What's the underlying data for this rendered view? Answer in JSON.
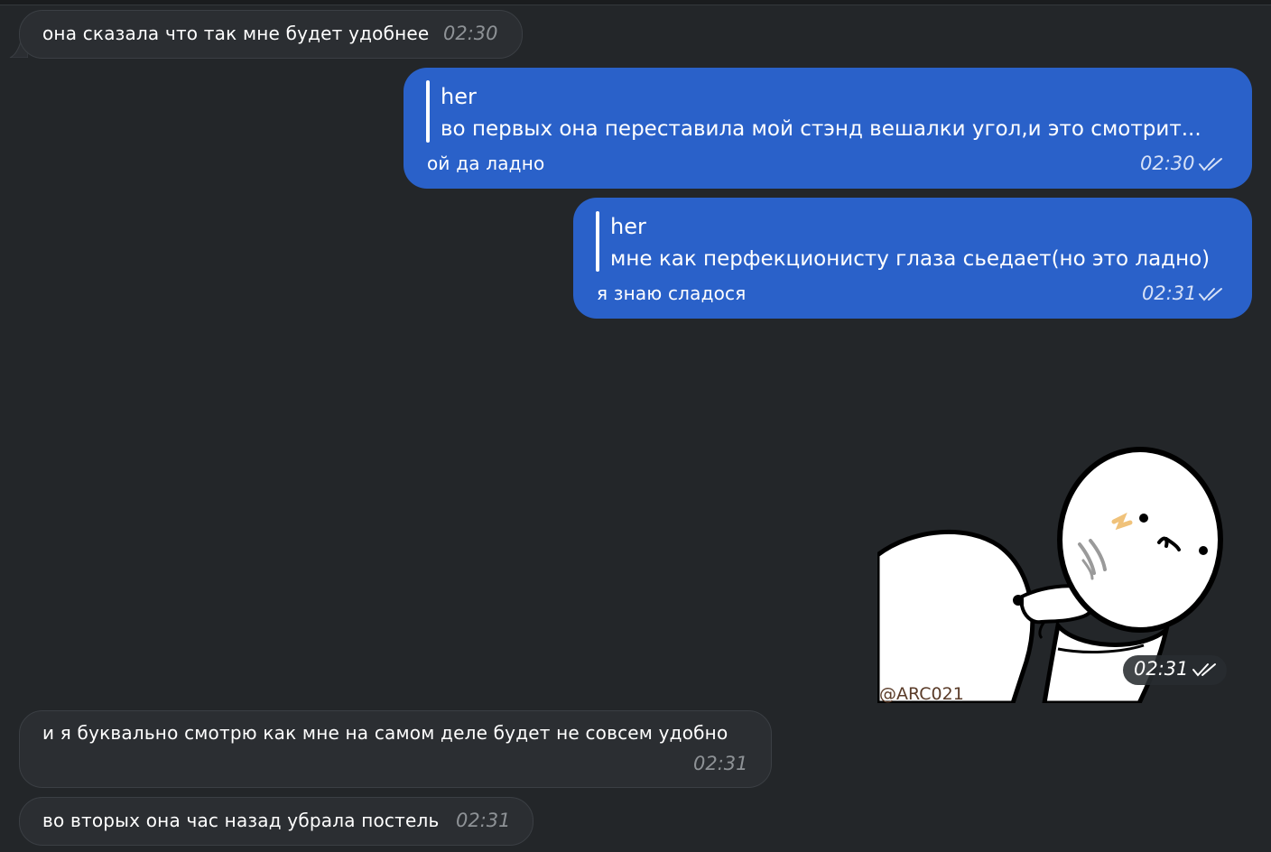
{
  "messages": [
    {
      "text": "она сказала что так мне будет удобнее",
      "time": "02:30"
    },
    {
      "reply_to": "her",
      "reply_text": "во первых она переставила мой стэнд вешалки угол,и это смотрит...",
      "text": "ой да ладно",
      "time": "02:30"
    },
    {
      "reply_to": "her",
      "reply_text": "мне как перфекционисту глаза сьедает(но это ладно)",
      "text": "я знаю сладося",
      "time": "02:31"
    },
    {
      "sticker_watermark": "@ARC021",
      "time": "02:31"
    },
    {
      "text": "и я буквально смотрю как мне на самом деле будет не совсем удобно",
      "time": "02:31"
    },
    {
      "text": "во вторых она час назад убрала постель",
      "time": "02:31"
    }
  ],
  "colors": {
    "background": "#232629",
    "incoming": "#2b2e32",
    "outgoing": "#2a61c9"
  },
  "icons": {
    "read_status": "double-check-icon",
    "sticker": "sticker-image"
  }
}
